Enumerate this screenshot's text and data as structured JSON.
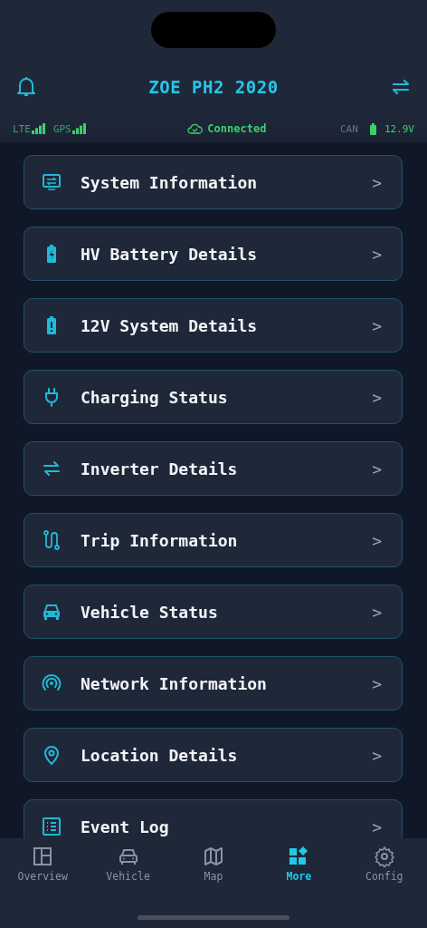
{
  "header": {
    "title": "ZOE PH2 2020"
  },
  "status_bar": {
    "lte_label": "LTE",
    "gps_label": "GPS",
    "connection": "Connected",
    "can_label": "CAN",
    "voltage": "12.9V"
  },
  "menu": [
    {
      "label": "System Information",
      "chevron": ">"
    },
    {
      "label": "HV Battery Details",
      "chevron": ">"
    },
    {
      "label": "12V System Details",
      "chevron": ">"
    },
    {
      "label": "Charging Status",
      "chevron": ">"
    },
    {
      "label": "Inverter Details",
      "chevron": ">"
    },
    {
      "label": "Trip Information",
      "chevron": ">"
    },
    {
      "label": "Vehicle Status",
      "chevron": ">"
    },
    {
      "label": "Network Information",
      "chevron": ">"
    },
    {
      "label": "Location Details",
      "chevron": ">"
    },
    {
      "label": "Event Log",
      "chevron": ">"
    }
  ],
  "tabs": [
    {
      "label": "Overview",
      "selected": false
    },
    {
      "label": "Vehicle",
      "selected": false
    },
    {
      "label": "Map",
      "selected": false
    },
    {
      "label": "More",
      "selected": true
    },
    {
      "label": "Config",
      "selected": false
    }
  ]
}
